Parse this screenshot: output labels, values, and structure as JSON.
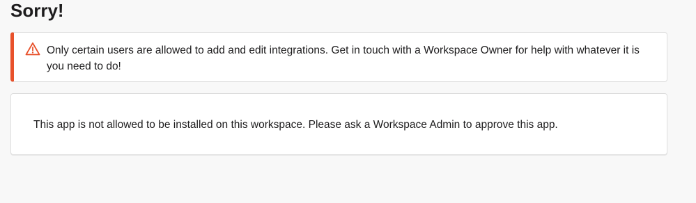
{
  "page": {
    "title": "Sorry!"
  },
  "alert": {
    "icon": "warning-triangle-icon",
    "accent_color": "#e8512b",
    "message": "Only certain users are allowed to add and edit integrations. Get in touch with a Workspace Owner for help with whatever it is you need to do!"
  },
  "card": {
    "message": "This app is not allowed to be installed on this workspace. Please ask a Workspace Admin to approve this app."
  }
}
